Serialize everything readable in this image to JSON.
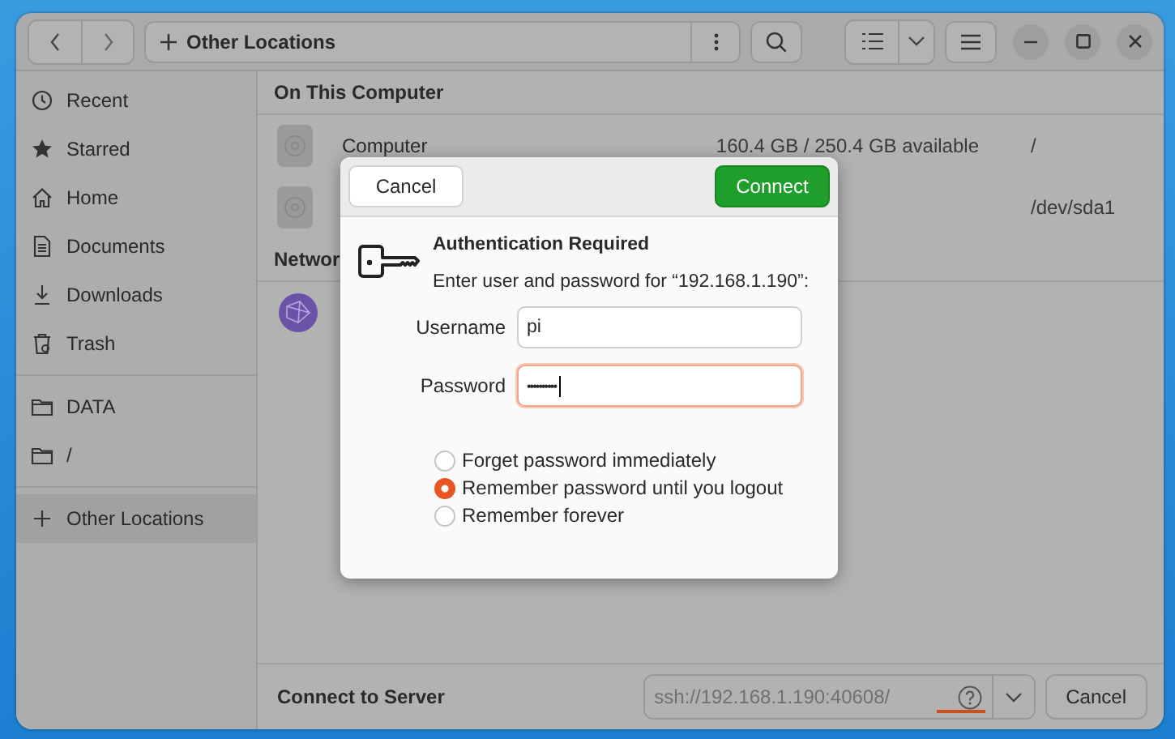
{
  "header": {
    "location": "Other Locations"
  },
  "sidebar": {
    "sections": [
      [
        {
          "label": "Recent",
          "kind": "recent",
          "selected": false
        },
        {
          "label": "Starred",
          "kind": "starred",
          "selected": false
        },
        {
          "label": "Home",
          "kind": "home",
          "selected": false
        },
        {
          "label": "Documents",
          "kind": "documents",
          "selected": false
        },
        {
          "label": "Downloads",
          "kind": "downloads",
          "selected": false
        },
        {
          "label": "Trash",
          "kind": "trash",
          "selected": false
        }
      ],
      [
        {
          "label": "DATA",
          "kind": "folder",
          "selected": false
        },
        {
          "label": "/",
          "kind": "folder",
          "selected": false
        }
      ],
      [
        {
          "label": "Other Locations",
          "kind": "plus",
          "selected": true
        }
      ]
    ]
  },
  "main": {
    "sections": [
      {
        "title": "On This Computer",
        "rows": [
          {
            "kind": "drive",
            "name": "Computer",
            "info": "160.4 GB / 250.4 GB available",
            "path": "/"
          },
          {
            "kind": "drive",
            "path": "/dev/sda1"
          }
        ]
      },
      {
        "title": "Networ",
        "rows": [
          {
            "kind": "network"
          }
        ]
      }
    ]
  },
  "dialog": {
    "cancel": "Cancel",
    "connect": "Connect",
    "title": "Authentication Required",
    "message": "Enter user and password for “192.168.1.190”:",
    "fields": [
      {
        "label": "Username",
        "value": "pi",
        "focused": false
      },
      {
        "label": "Password",
        "value": "••••••••••",
        "focused": true
      }
    ],
    "options": [
      {
        "label": "Forget password immediately",
        "selected": false
      },
      {
        "label": "Remember password until you logout",
        "selected": true
      },
      {
        "label": "Remember forever",
        "selected": false
      }
    ]
  },
  "bottom_bar": {
    "label": "Connect to Server",
    "server": "ssh://192.168.1.190:40608/",
    "cancel": "Cancel"
  }
}
